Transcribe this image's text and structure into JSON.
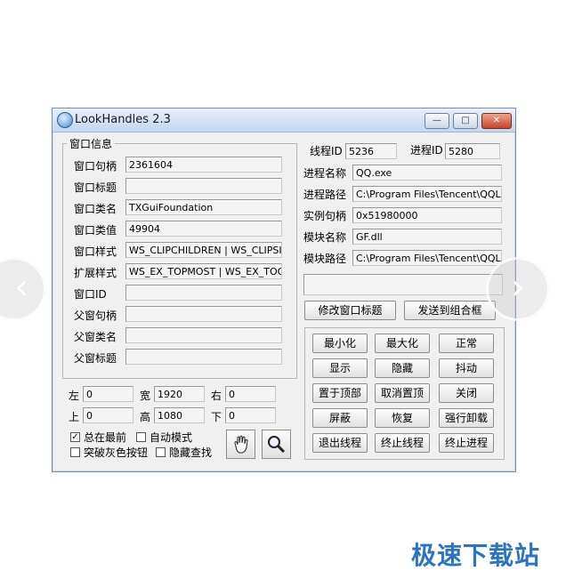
{
  "window": {
    "title": "LookHandles 2.3",
    "minimize_glyph": "—",
    "maximize_glyph": "□",
    "close_glyph": "✕"
  },
  "window_info": {
    "group_label": "窗口信息",
    "rows": [
      {
        "label": "窗口句柄",
        "value": "2361604"
      },
      {
        "label": "窗口标题",
        "value": ""
      },
      {
        "label": "窗口类名",
        "value": "TXGuiFoundation"
      },
      {
        "label": "窗口类值",
        "value": "49904"
      },
      {
        "label": "窗口样式",
        "value": "WS_CLIPCHILDREN | WS_CLIPSIBLI"
      },
      {
        "label": "扩展样式",
        "value": "WS_EX_TOPMOST | WS_EX_TOOLW"
      },
      {
        "label": "窗口ID",
        "value": ""
      },
      {
        "label": "父窗句柄",
        "value": ""
      },
      {
        "label": "父窗类名",
        "value": ""
      },
      {
        "label": "父窗标题",
        "value": ""
      }
    ]
  },
  "geometry_fields": {
    "left_label": "左",
    "left_value": "0",
    "width_label": "宽",
    "width_value": "1920",
    "right_label": "右",
    "right_value": "0",
    "top_label": "上",
    "top_value": "0",
    "height_label": "高",
    "height_value": "1080",
    "bottom_label": "下",
    "bottom_value": "0"
  },
  "options": {
    "always_on_top": {
      "label": "总在最前",
      "checked": true
    },
    "auto_mode": {
      "label": "自动模式",
      "checked": false
    },
    "break_gray_button": {
      "label": "突破灰色按钮",
      "checked": false
    },
    "hidden_search": {
      "label": "隐藏查找",
      "checked": false
    }
  },
  "tools": {
    "hand_icon": "hand-icon",
    "magnifier_icon": "magnifier-icon"
  },
  "process_info": {
    "thread_id_label": "线程ID",
    "thread_id_value": "5236",
    "process_id_label": "进程ID",
    "process_id_value": "5280",
    "rows": [
      {
        "label": "进程名称",
        "value": "QQ.exe"
      },
      {
        "label": "进程路径",
        "value": "C:\\Program Files\\Tencent\\QQLite\\"
      },
      {
        "label": "实例句柄",
        "value": "0x51980000"
      },
      {
        "label": "模块名称",
        "value": "GF.dll"
      },
      {
        "label": "模块路径",
        "value": "C:\\Program Files\\Tencent\\QQLite\\"
      }
    ],
    "extra_field": ""
  },
  "actions": {
    "modify_title": "修改窗口标题",
    "send_to_combo": "发送到组合框",
    "grid": [
      [
        "最小化",
        "最大化",
        "正常"
      ],
      [
        "显示",
        "隐藏",
        "抖动"
      ],
      [
        "置于顶部",
        "取消置顶",
        "关闭"
      ],
      [
        "屏蔽",
        "恢复",
        "强行卸载"
      ],
      [
        "退出线程",
        "终止线程",
        "终止进程"
      ]
    ]
  },
  "overlay": {
    "prev_glyph": "‹",
    "next_glyph": "›",
    "watermark": "极速下载站"
  }
}
